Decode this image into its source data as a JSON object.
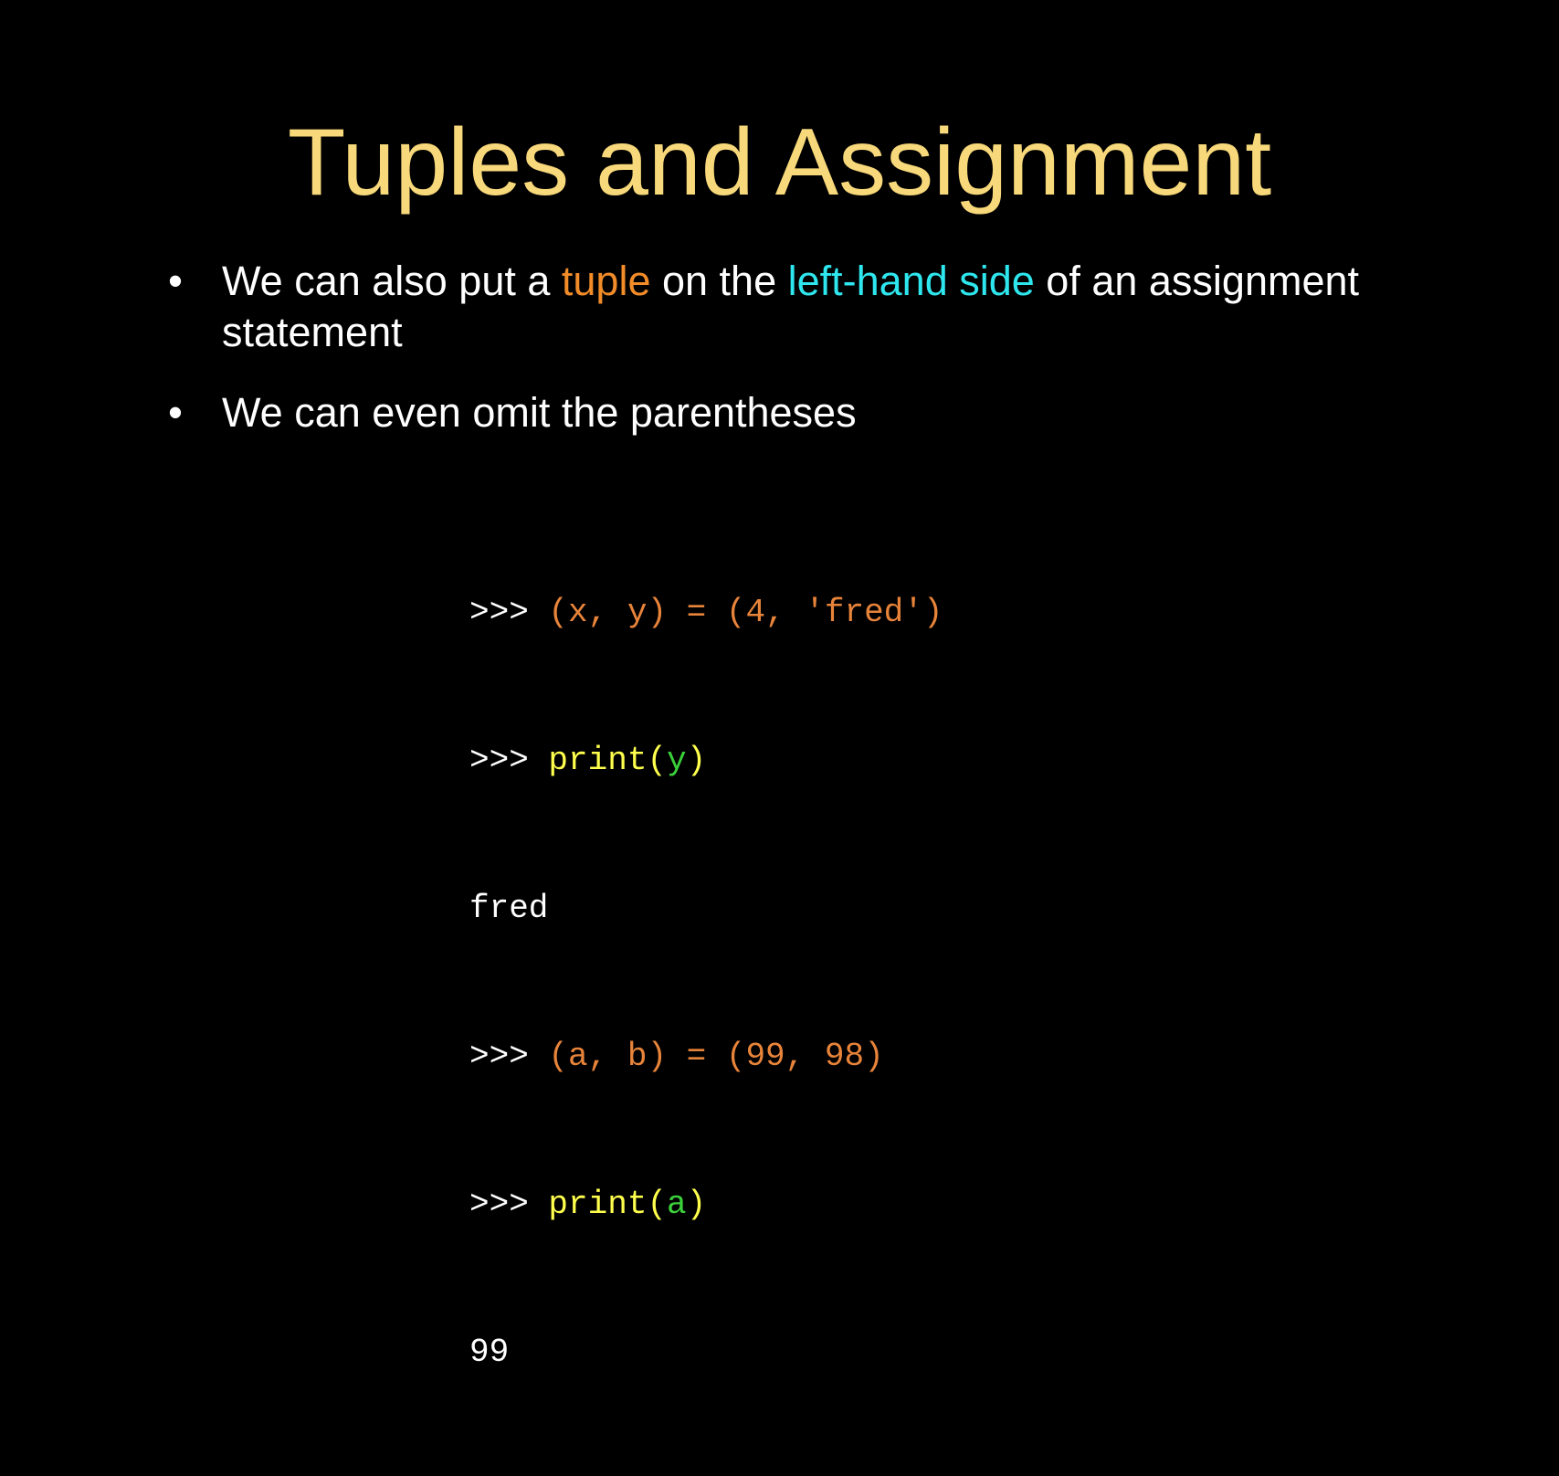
{
  "colors": {
    "background": "#000000",
    "title": "#f7d87a",
    "text": "#ffffff",
    "orange": "#f28c28",
    "cyan": "#2ee6ee",
    "yellow": "#ffff4d",
    "green": "#3ad13a",
    "code_orange": "#e8843a"
  },
  "slide": {
    "title": "Tuples and Assignment",
    "bullets": [
      {
        "marker": "•",
        "segments": [
          {
            "text": "We can also put a ",
            "color": "#ffffff"
          },
          {
            "text": "tuple",
            "color": "#f28c28"
          },
          {
            "text": " on the ",
            "color": "#ffffff"
          },
          {
            "text": "left-hand side",
            "color": "#2ee6ee"
          },
          {
            "text": " of an assignment statement",
            "color": "#ffffff"
          }
        ]
      },
      {
        "marker": "•",
        "segments": [
          {
            "text": "We can even omit the parentheses",
            "color": "#ffffff"
          }
        ]
      }
    ],
    "code_lines": [
      [
        {
          "text": ">>> ",
          "color": "#ffffff"
        },
        {
          "text": "(x, y) = (4, 'fred')",
          "color": "#e8843a"
        }
      ],
      [
        {
          "text": ">>> ",
          "color": "#ffffff"
        },
        {
          "text": "print(",
          "color": "#ffff4d"
        },
        {
          "text": "y",
          "color": "#3ad13a"
        },
        {
          "text": ")",
          "color": "#ffff4d"
        }
      ],
      [
        {
          "text": "fred",
          "color": "#ffffff"
        }
      ],
      [
        {
          "text": ">>> ",
          "color": "#ffffff"
        },
        {
          "text": "(a, b) = (99, 98)",
          "color": "#e8843a"
        }
      ],
      [
        {
          "text": ">>> ",
          "color": "#ffffff"
        },
        {
          "text": "print(",
          "color": "#ffff4d"
        },
        {
          "text": "a",
          "color": "#3ad13a"
        },
        {
          "text": ")",
          "color": "#ffff4d"
        }
      ],
      [
        {
          "text": "99",
          "color": "#ffffff"
        }
      ]
    ]
  }
}
